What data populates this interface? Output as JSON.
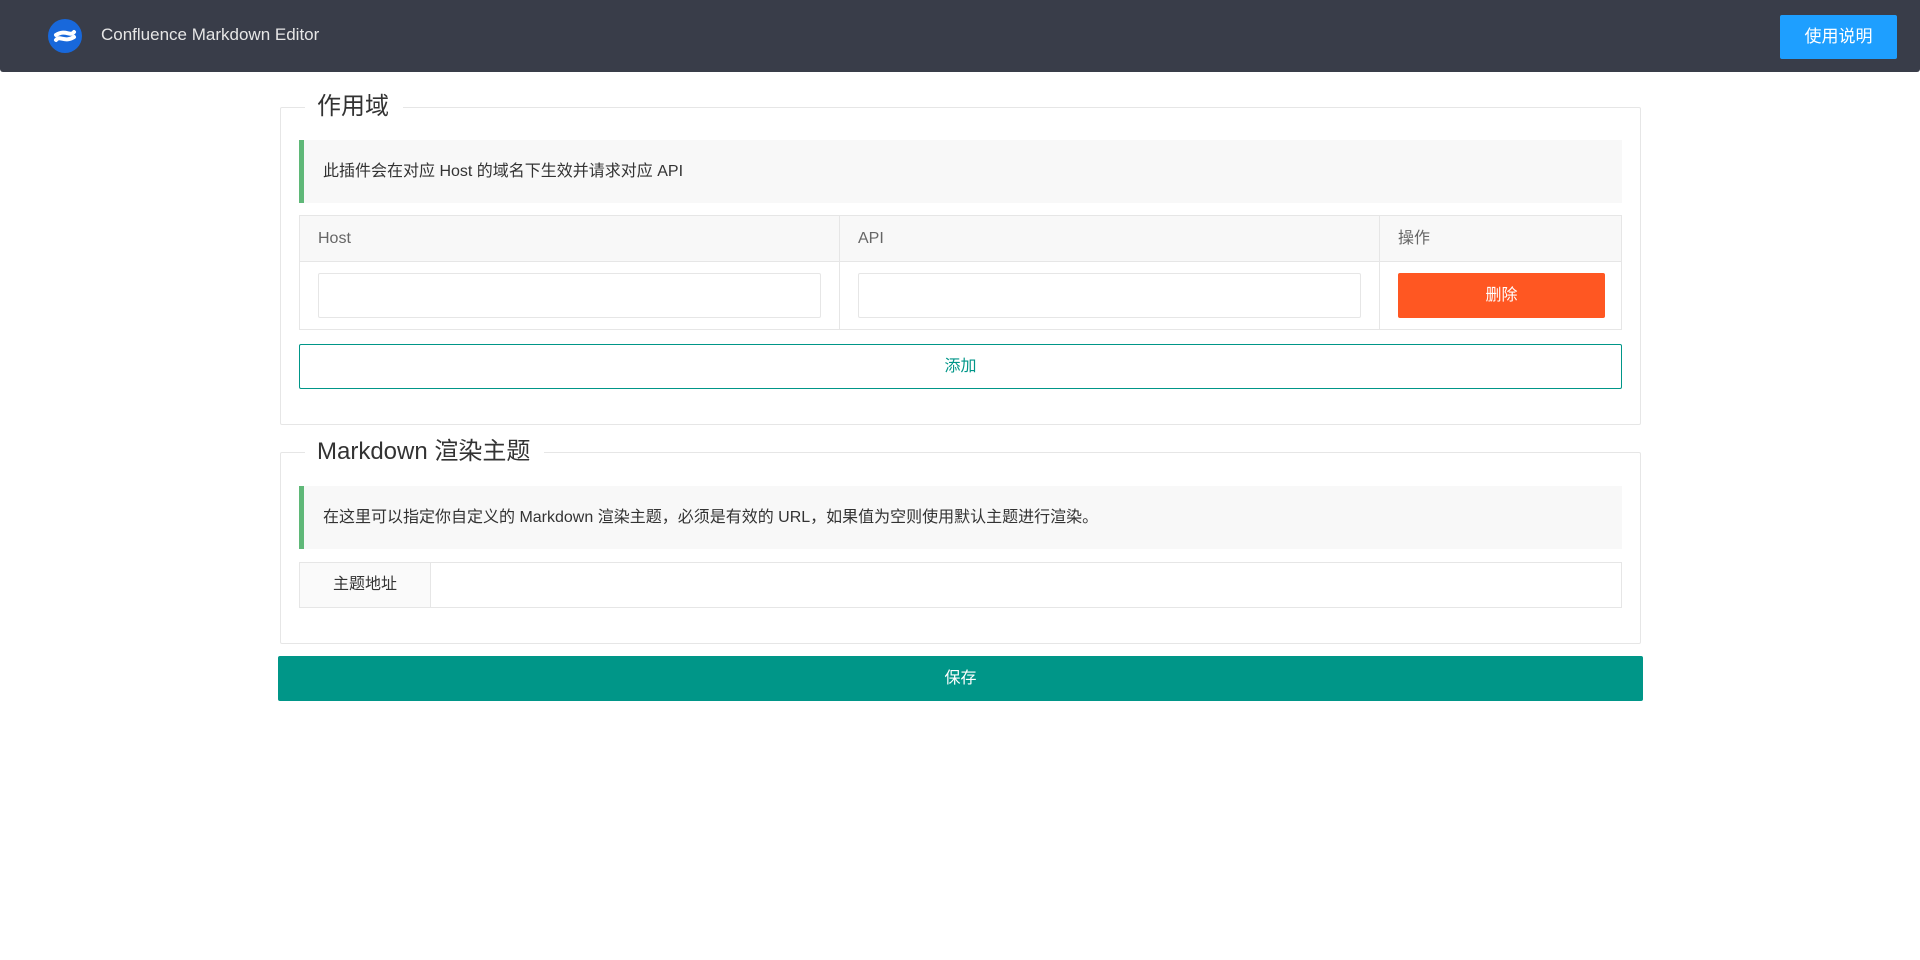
{
  "header": {
    "app_title": "Confluence Markdown Editor",
    "help_button_label": "使用说明",
    "logo_icon": "confluence-logo-icon",
    "logo_color": "#1868db"
  },
  "scope_section": {
    "legend": "作用域",
    "hint": "此插件会在对应 Host 的域名下生效并请求对应 API",
    "table": {
      "headers": [
        "Host",
        "API",
        "操作"
      ],
      "rows": [
        {
          "host": "",
          "api": "",
          "delete_label": "删除"
        }
      ]
    },
    "add_button_label": "添加"
  },
  "theme_section": {
    "legend": "Markdown 渲染主题",
    "hint": "在这里可以指定你自定义的 Markdown 渲染主题，必须是有效的 URL，如果值为空则使用默认主题进行渲染。",
    "field_label": "主题地址",
    "field_value": ""
  },
  "save_button_label": "保存",
  "colors": {
    "header_bg": "#393d49",
    "help_button": "#1e9fff",
    "delete_button": "#ff5722",
    "primary": "#009688",
    "quote_border": "#5fb878"
  }
}
